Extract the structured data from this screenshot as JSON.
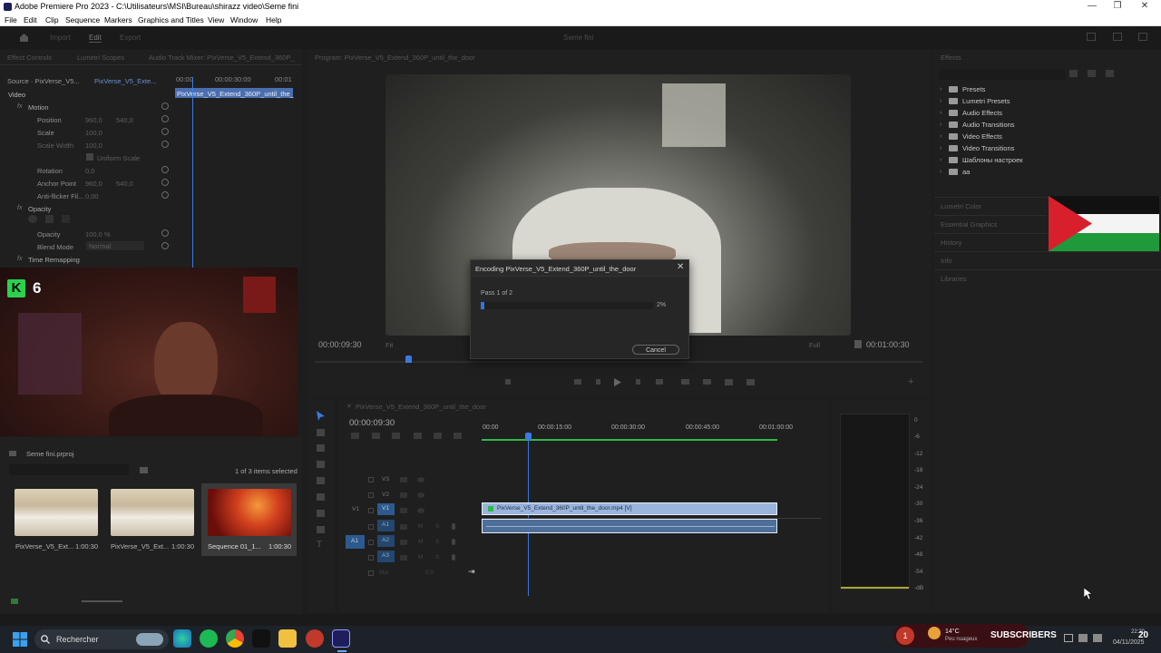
{
  "window": {
    "title": "Adobe Premiere Pro 2023 - C:\\Utilisateurs\\MSI\\Bureau\\shirazz video\\Seme fini",
    "minimize": "—",
    "restore": "❐",
    "close": "✕"
  },
  "menu": [
    "File",
    "Edit",
    "Clip",
    "Sequence",
    "Markers",
    "Graphics and Titles",
    "View",
    "Window",
    "Help"
  ],
  "appbar": {
    "import": "Import",
    "edit": "Edit",
    "export": "Export",
    "project_title": "Seme fini"
  },
  "effect_controls": {
    "tabs": [
      "Effect Controls",
      "Lumetri Scopes",
      "Audio Track Mixer: PixVerse_V5_Extend_360P_"
    ],
    "source": "Source · PixVerse_V5...",
    "clip": "PixVerse_V5_Exte...",
    "time_start": "00:00",
    "time_mid": "00:00:30:00",
    "time_end": "00:01",
    "clip_bar": "PixVerse_V5_Extend_360P_until_the_",
    "video_label": "Video",
    "rows": [
      {
        "name": "Motion",
        "v1": "",
        "v2": ""
      },
      {
        "name": "Position",
        "v1": "960,0",
        "v2": "540,0"
      },
      {
        "name": "Scale",
        "v1": "100,0",
        "v2": ""
      },
      {
        "name": "Scale Width",
        "v1": "100,0",
        "v2": ""
      },
      {
        "name": "Uniform Scale",
        "v1": "",
        "v2": ""
      },
      {
        "name": "Rotation",
        "v1": "0,0",
        "v2": ""
      },
      {
        "name": "Anchor Point",
        "v1": "960,0",
        "v2": "540,0"
      },
      {
        "name": "Anti-flicker Fil...",
        "v1": "0,00",
        "v2": ""
      },
      {
        "name": "Opacity",
        "v1": "",
        "v2": ""
      },
      {
        "name": "Opacity",
        "v1": "100,0 %",
        "v2": ""
      },
      {
        "name": "Blend Mode",
        "v1": "Normal",
        "v2": ""
      },
      {
        "name": "Time Remapping",
        "v1": "",
        "v2": ""
      }
    ]
  },
  "webcam": {
    "badge_letter": "K",
    "badge_count": "6"
  },
  "project": {
    "name": "Seme fini.prproj",
    "selection": "1 of 3 items selected",
    "items": [
      {
        "name": "PixVerse_V5_Ext...",
        "dur": "1:00:30"
      },
      {
        "name": "PixVerse_V5_Ext...",
        "dur": "1:00:30"
      },
      {
        "name": "Sequence 01_1...",
        "dur": "1:00:30"
      }
    ]
  },
  "program": {
    "tab": "Program: PixVerse_V5_Extend_360P_until_the_door",
    "timecode": "00:00:09:30",
    "fit": "Fit",
    "full": "Full",
    "duration": "00:01:00:30"
  },
  "dialog": {
    "title": "Encoding PixVerse_V5_Extend_360P_until_the_door",
    "pass": "Pass 1 of 2",
    "percent": "2%",
    "progress": 2,
    "cancel": "Cancel"
  },
  "effects": {
    "tab": "Effects",
    "items": [
      "Presets",
      "Lumetri Presets",
      "Audio Effects",
      "Audio Transitions",
      "Video Effects",
      "Video Transitions",
      "Шаблоны настроек",
      "aa"
    ],
    "collapsed": [
      "Lumetri Color",
      "Essential Graphics",
      "History",
      "Info",
      "Libraries"
    ]
  },
  "timeline": {
    "tab": "PixVerse_V5_Extend_360P_until_the_door",
    "timecode": "00:00:09:30",
    "ruler": [
      "00:00",
      "00:00:15:00",
      "00:00:30:00",
      "00:00:45:00",
      "00:01:00:00"
    ],
    "tracks": [
      "V3",
      "V2",
      "V1",
      "A1",
      "A2",
      "A3"
    ],
    "clip_label": "PixVerse_V5_Extend_360P_until_the_door.mp4 [V]",
    "mix": "Mix",
    "mix_val": "0,0",
    "src_v": "V1",
    "src_a": "A1"
  },
  "meter": {
    "labels": [
      "0",
      "-6",
      "-12",
      "-18",
      "-24",
      "-30",
      "-36",
      "-42",
      "-48",
      "-54",
      "-dB"
    ]
  },
  "taskbar": {
    "search": "Rechercher",
    "weather": "14°C",
    "weather_sub": "Peu nuageux",
    "subscribers": "SUBSCRIBERS",
    "notif": "1",
    "count": "20",
    "time": "22:20",
    "date": "04/11/2025"
  }
}
